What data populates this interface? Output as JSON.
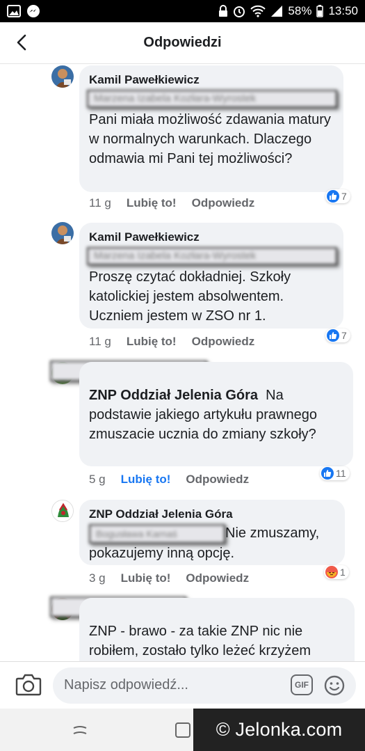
{
  "statusbar": {
    "battery": "58%",
    "time": "13:50"
  },
  "header": {
    "title": "Odpowiedzi"
  },
  "comments": [
    {
      "author": "Kamil Pawełkiewicz",
      "mention": "Marzena Izabela Kozłara-Wyrostek",
      "text": "Pani miała możliwość zdawania matury w normalnych warunkach. Dlaczego odmawia mi Pani tej możliwości?",
      "time": "11 g",
      "like": "Lubię to!",
      "reply": "Odpowiedz",
      "reaction_count": "7",
      "reaction": "like"
    },
    {
      "author": "Kamil Pawełkiewicz",
      "mention": "Marzena Izabela Kozłara-Wyrostek",
      "text": "Proszę czytać dokładniej. Szkoły katolickiej jestem absolwentem. Uczniem jestem w ZSO nr 1.",
      "time": "11 g",
      "like": "Lubię to!",
      "reply": "Odpowiedz",
      "reaction_count": "7",
      "reaction": "like"
    },
    {
      "author": "Bogusława Karnaś",
      "mention": "ZNP Oddział Jelenia Góra",
      "text": "Na podstawie jakiego artykułu prawnego zmuszacie ucznia do zmiany szkoły?",
      "time": "5 g",
      "like": "Lubię to!",
      "reply": "Odpowiedz",
      "reaction_count": "11",
      "reaction": "like"
    },
    {
      "author": "ZNP Oddział Jelenia Góra",
      "mention": "Bogusława Karnaś",
      "text": "Nie zmuszamy, pokazujemy inną opcję.",
      "time": "3 g",
      "like": "Lubię to!",
      "reply": "Odpowiedz",
      "reaction_count": "1",
      "reaction": "angry"
    },
    {
      "author": "Michał Pietrzak",
      "text": "ZNP - brawo - za takie ZNP nic nie robiłem, zostało tylko leżeć krzyżem"
    }
  ],
  "composer": {
    "placeholder": "Napisz odpowiedź...",
    "gif_label": "GIF"
  },
  "watermark": "© Jelonka.com",
  "colors": {
    "accent": "#1877f2",
    "bubble": "#f0f2f5",
    "angry": "#f0584a"
  }
}
